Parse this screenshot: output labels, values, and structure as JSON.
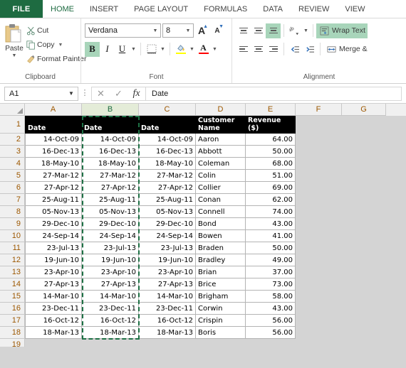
{
  "app": {
    "file_tab": "FILE",
    "tabs": [
      {
        "label": "HOME",
        "active": true
      },
      {
        "label": "INSERT",
        "active": false
      },
      {
        "label": "PAGE LAYOUT",
        "active": false
      },
      {
        "label": "FORMULAS",
        "active": false
      },
      {
        "label": "DATA",
        "active": false
      },
      {
        "label": "REVIEW",
        "active": false
      },
      {
        "label": "VIEW",
        "active": false
      }
    ]
  },
  "ribbon": {
    "clipboard": {
      "group_label": "Clipboard",
      "paste_label": "Paste",
      "items": [
        {
          "label": "Cut",
          "icon": "scissors-icon"
        },
        {
          "label": "Copy",
          "icon": "copy-icon"
        },
        {
          "label": "Format Painter",
          "icon": "format-painter-icon"
        }
      ]
    },
    "font": {
      "group_label": "Font",
      "font_name": "Verdana",
      "font_size": "8",
      "grow_label": "A",
      "shrink_label": "A",
      "bold": "B",
      "bold_active": true,
      "italic": "I",
      "underline": "U",
      "fill_color": "#FFFF00",
      "font_color": "#FF0000"
    },
    "alignment": {
      "group_label": "Alignment",
      "wrap_text": "Wrap Text",
      "wrap_active": true,
      "merge_center": "Merge &",
      "valign_bottom_active": true
    }
  },
  "formula_bar": {
    "name_box": "A1",
    "cancel_icon": "cancel-icon",
    "enter_icon": "enter-icon",
    "fx_icon": "fx",
    "formula_value": "Date"
  },
  "grid": {
    "columns": [
      "A",
      "B",
      "C",
      "D",
      "E",
      "F",
      "G"
    ],
    "selected_column": "B",
    "row_numbers": [
      "1",
      "2",
      "3",
      "4",
      "5",
      "6",
      "7",
      "8",
      "9",
      "10",
      "11",
      "12",
      "13",
      "14",
      "15",
      "16",
      "17",
      "18",
      "19"
    ],
    "headers": [
      "Date",
      "Date",
      "Date",
      "Customer Name",
      "Revenue ($)"
    ],
    "rows": [
      [
        "14-Oct-09",
        "14-Oct-09",
        "14-Oct-09",
        "Aaron",
        "64.00"
      ],
      [
        "16-Dec-13",
        "16-Dec-13",
        "16-Dec-13",
        "Abbott",
        "50.00"
      ],
      [
        "18-May-10",
        "18-May-10",
        "18-May-10",
        "Coleman",
        "68.00"
      ],
      [
        "27-Mar-12",
        "27-Mar-12",
        "27-Mar-12",
        "Colin",
        "51.00"
      ],
      [
        "27-Apr-12",
        "27-Apr-12",
        "27-Apr-12",
        "Collier",
        "69.00"
      ],
      [
        "25-Aug-11",
        "25-Aug-11",
        "25-Aug-11",
        "Conan",
        "62.00"
      ],
      [
        "05-Nov-13",
        "05-Nov-13",
        "05-Nov-13",
        "Connell",
        "74.00"
      ],
      [
        "29-Dec-10",
        "29-Dec-10",
        "29-Dec-10",
        "Bond",
        "43.00"
      ],
      [
        "24-Sep-14",
        "24-Sep-14",
        "24-Sep-14",
        "Bowen",
        "41.00"
      ],
      [
        "23-Jul-13",
        "23-Jul-13",
        "23-Jul-13",
        "Braden",
        "50.00"
      ],
      [
        "19-Jun-10",
        "19-Jun-10",
        "19-Jun-10",
        "Bradley",
        "49.00"
      ],
      [
        "23-Apr-10",
        "23-Apr-10",
        "23-Apr-10",
        "Brian",
        "37.00"
      ],
      [
        "27-Apr-13",
        "27-Apr-13",
        "27-Apr-13",
        "Brice",
        "73.00"
      ],
      [
        "14-Mar-10",
        "14-Mar-10",
        "14-Mar-10",
        "Brigham",
        "58.00"
      ],
      [
        "23-Dec-11",
        "23-Dec-11",
        "23-Dec-11",
        "Corwin",
        "43.00"
      ],
      [
        "16-Oct-12",
        "16-Oct-12",
        "16-Oct-12",
        "Crispin",
        "56.00"
      ],
      [
        "18-Mar-13",
        "18-Mar-13",
        "18-Mar-13",
        "Boris",
        "56.00"
      ]
    ]
  },
  "colors": {
    "excel_green": "#1e6b41",
    "header_black": "#000000",
    "marching_ants": "#1e7145",
    "highlight_green": "#a8d5ba",
    "header_text_orange": "#9c5700"
  }
}
